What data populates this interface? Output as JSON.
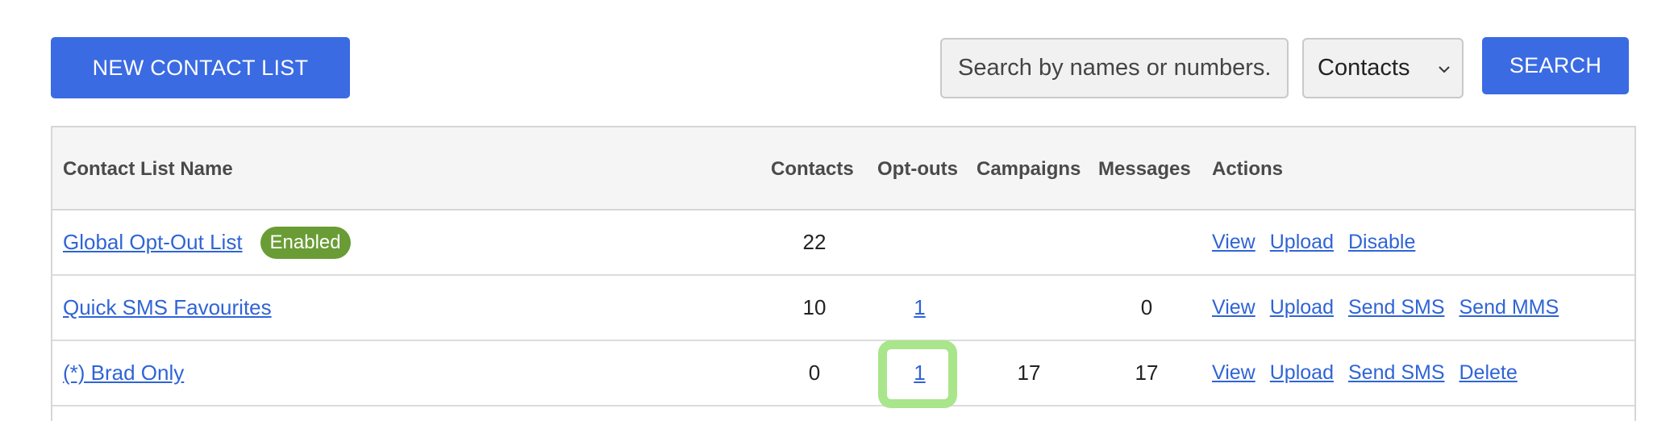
{
  "toolbar": {
    "new_list_label": "NEW CONTACT LIST",
    "search_placeholder": "Search by names or numbers...",
    "search_value": "",
    "filter_selected": "Contacts",
    "search_label": "SEARCH"
  },
  "table": {
    "headers": {
      "name": "Contact List Name",
      "contacts": "Contacts",
      "optouts": "Opt-outs",
      "campaigns": "Campaigns",
      "messages": "Messages",
      "actions": "Actions"
    },
    "rows": [
      {
        "name": "Global Opt-Out List",
        "badge": "Enabled",
        "contacts": "22",
        "optouts": "",
        "campaigns": "",
        "messages": "",
        "actions": [
          "View",
          "Upload",
          "Disable"
        ]
      },
      {
        "name": "Quick SMS Favourites",
        "badge": "",
        "contacts": "10",
        "optouts": "1",
        "campaigns": "",
        "messages": "0",
        "actions": [
          "View",
          "Upload",
          "Send SMS",
          "Send MMS"
        ]
      },
      {
        "name": "(*) Brad Only",
        "badge": "",
        "contacts": "0",
        "optouts": "1",
        "campaigns": "17",
        "messages": "17",
        "actions": [
          "View",
          "Upload",
          "Send SMS",
          "Delete"
        ]
      }
    ]
  },
  "colors": {
    "primary": "#3a6be3",
    "link": "#2f64d6",
    "badge": "#6a9c35",
    "highlight": "#a9e58a"
  },
  "icons": {
    "filter_dropdown": "chevron-down-icon"
  }
}
